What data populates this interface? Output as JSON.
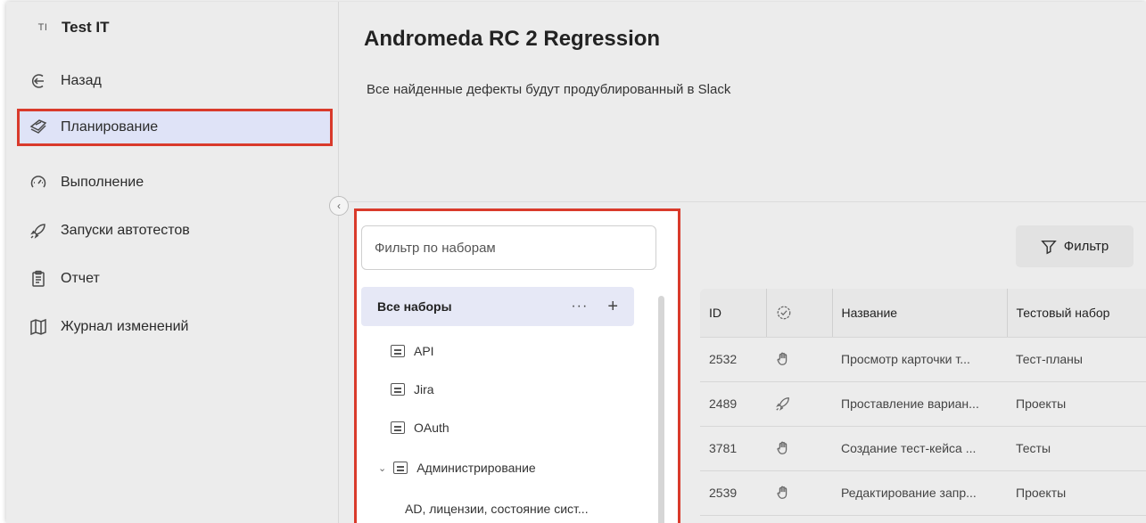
{
  "app": {
    "badge": "TI",
    "name": "Test IT"
  },
  "sidebar": {
    "items": [
      {
        "label": "Назад",
        "icon": "back-arrow-icon"
      },
      {
        "label": "Планирование",
        "icon": "planning-icon",
        "active": true
      },
      {
        "label": "Выполнение",
        "icon": "gauge-icon"
      },
      {
        "label": "Запуски автотестов",
        "icon": "rocket-icon"
      },
      {
        "label": "Отчет",
        "icon": "clipboard-icon"
      },
      {
        "label": "Журнал изменений",
        "icon": "book-icon"
      }
    ]
  },
  "page": {
    "title": "Andromeda RC 2 Regression",
    "description": "Все найденные дефекты будут продублированный в Slack"
  },
  "suites": {
    "filter_placeholder": "Фильтр по наборам",
    "all_label": "Все наборы",
    "more_label": "···",
    "add_label": "+",
    "items": [
      {
        "label": "API"
      },
      {
        "label": "Jira"
      },
      {
        "label": "OAuth"
      },
      {
        "label": "Администрирование",
        "expanded": true
      },
      {
        "label": "AD, лицензии, состояние сист..."
      }
    ]
  },
  "filter_button": {
    "label": "Фильтр"
  },
  "table": {
    "columns": [
      "ID",
      "status-icon",
      "Название",
      "Тестовый набор"
    ],
    "rows": [
      {
        "id": "2532",
        "type": "manual-hand-icon",
        "name": "Просмотр карточки т...",
        "suite": "Тест-планы"
      },
      {
        "id": "2489",
        "type": "automated-rocket-icon",
        "name": "Проставление вариан...",
        "suite": "Проекты"
      },
      {
        "id": "3781",
        "type": "manual-hand-icon",
        "name": "Создание тест-кейса ...",
        "suite": "Тесты"
      },
      {
        "id": "2539",
        "type": "manual-hand-icon",
        "name": "Редактирование запр...",
        "suite": "Проекты"
      }
    ]
  },
  "colors": {
    "highlight": "#d93a2b",
    "active_bg": "#dfe3f7",
    "background": "#ececec"
  }
}
